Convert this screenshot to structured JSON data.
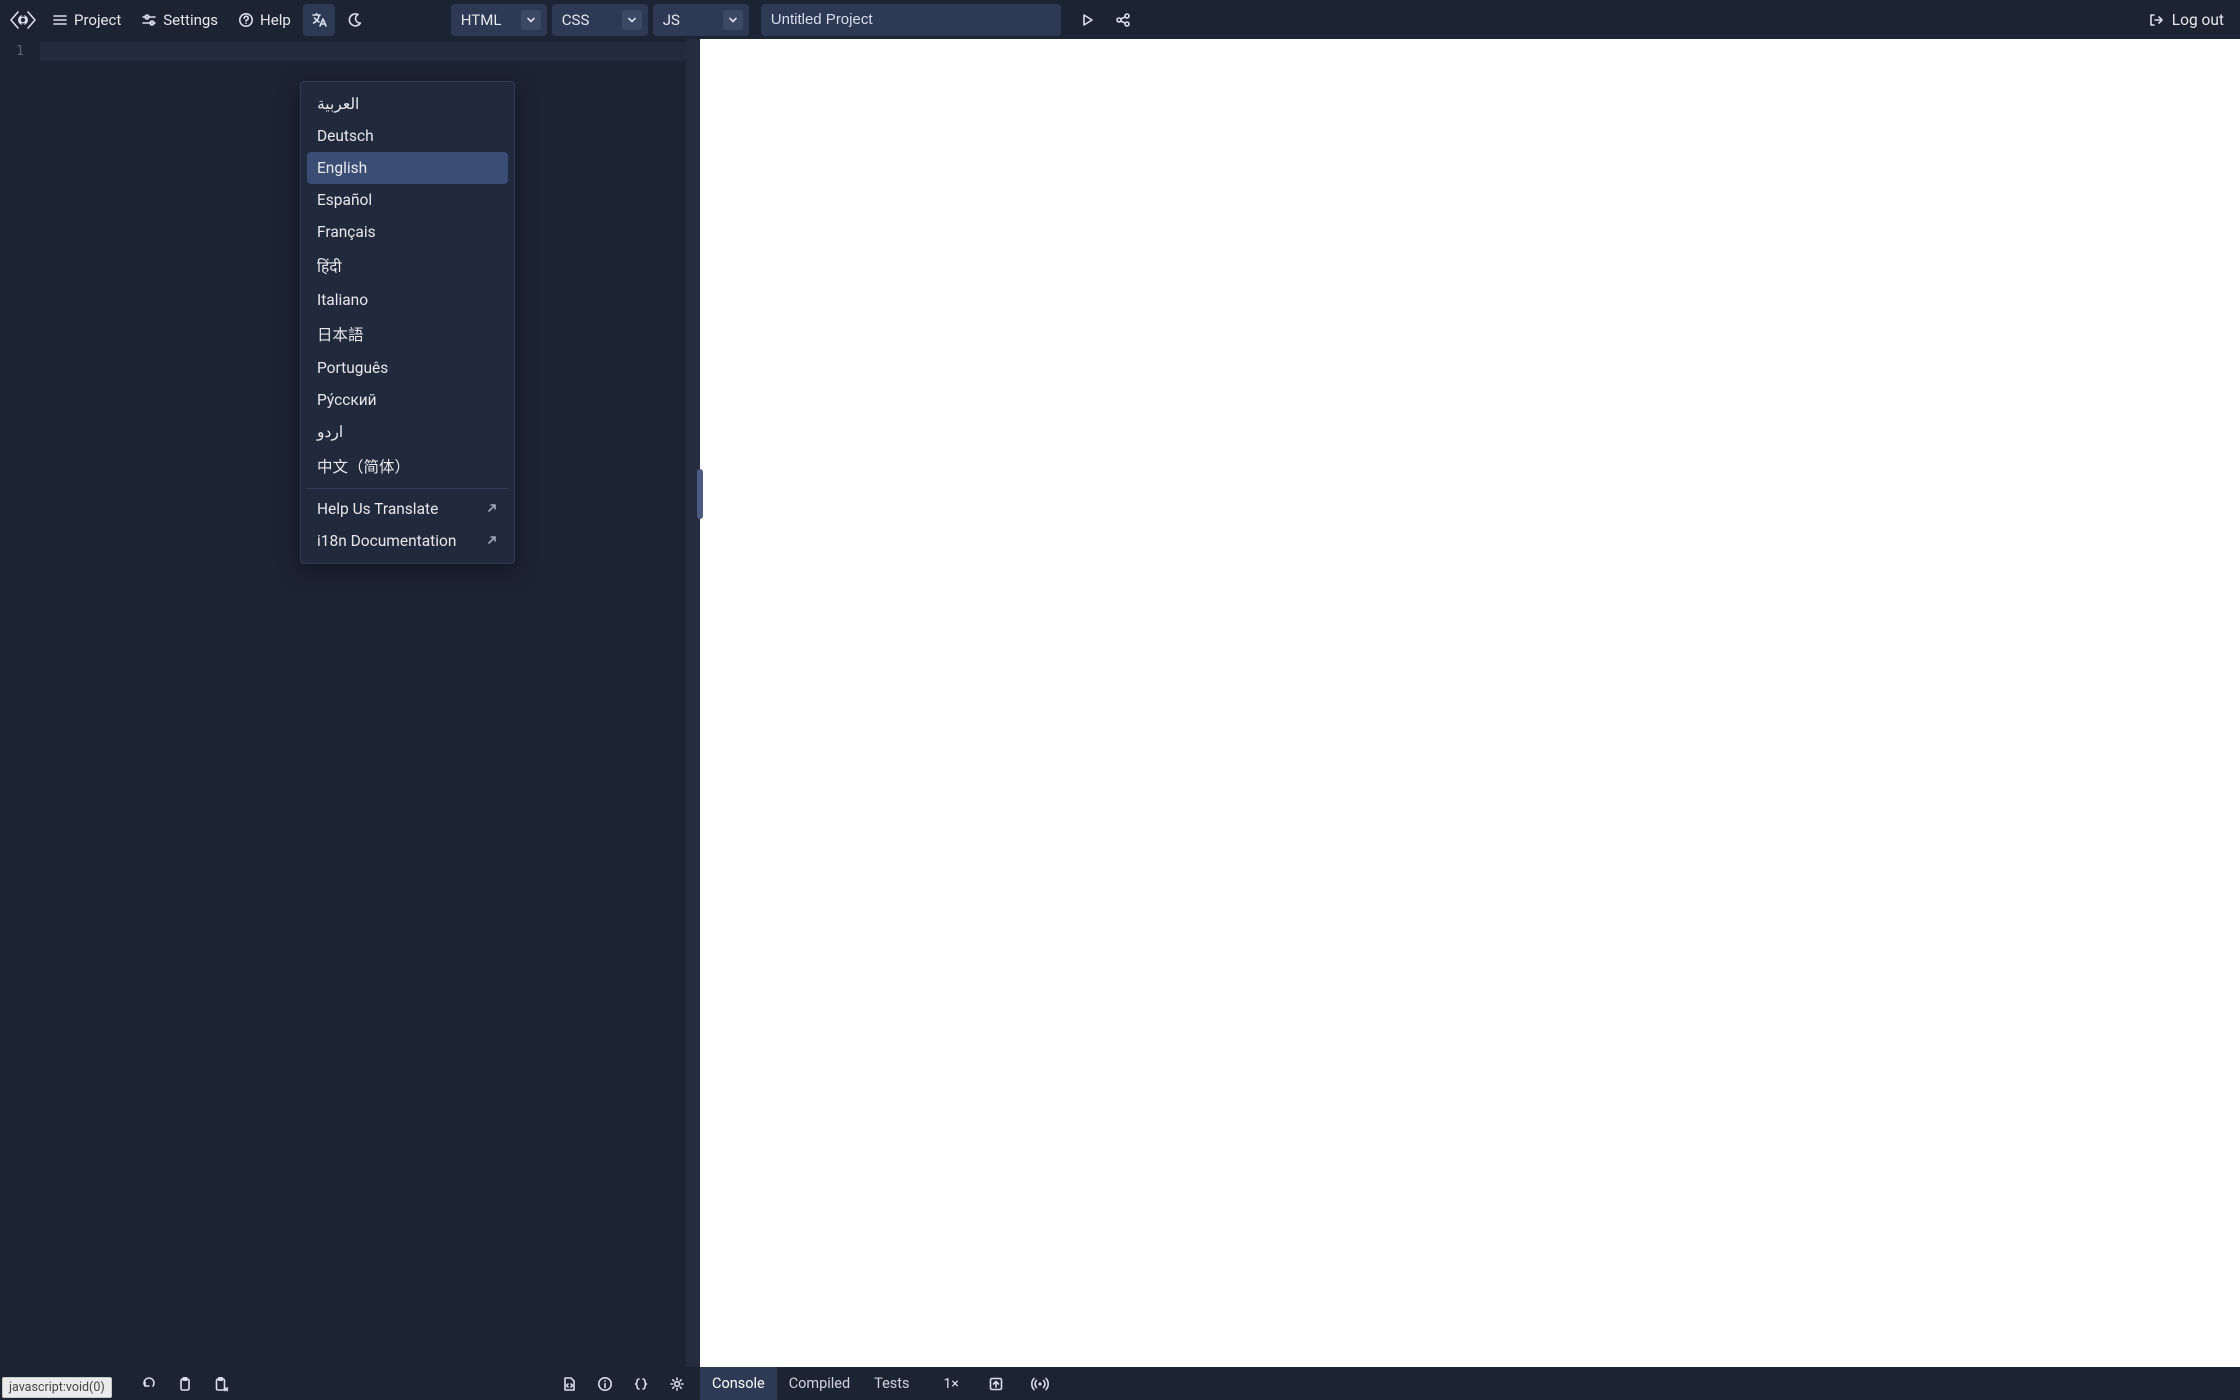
{
  "toolbar": {
    "project_label": "Project",
    "settings_label": "Settings",
    "help_label": "Help",
    "logout_label": "Log out",
    "title_value": "Untitled Project"
  },
  "tabs": {
    "html": "HTML",
    "css": "CSS",
    "js": "JS"
  },
  "editor": {
    "line_number": "1"
  },
  "language_menu": {
    "items": [
      {
        "label": "العربية",
        "selected": false
      },
      {
        "label": "Deutsch",
        "selected": false
      },
      {
        "label": "English",
        "selected": true
      },
      {
        "label": "Español",
        "selected": false
      },
      {
        "label": "Français",
        "selected": false
      },
      {
        "label": "हिंदी",
        "selected": false
      },
      {
        "label": "Italiano",
        "selected": false
      },
      {
        "label": "日本語",
        "selected": false
      },
      {
        "label": "Português",
        "selected": false
      },
      {
        "label": "Ру́сский",
        "selected": false
      },
      {
        "label": "اردو",
        "selected": false
      },
      {
        "label": "中文（简体）",
        "selected": false
      }
    ],
    "footer": {
      "help_translate": "Help Us Translate",
      "i18n_docs": "i18n Documentation"
    }
  },
  "bottom": {
    "console_label": "Console",
    "compiled_label": "Compiled",
    "tests_label": "Tests",
    "zoom_label": "1×"
  },
  "status_link": "javascript:void(0)"
}
